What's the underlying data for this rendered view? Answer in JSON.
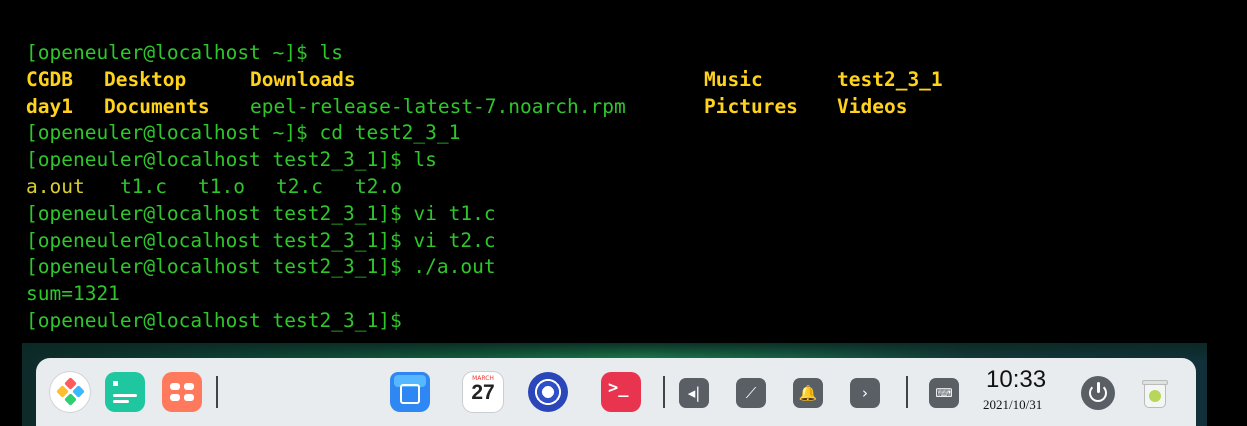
{
  "terminal": {
    "lines": [
      {
        "prompt": "[openeuler@localhost ~]$ ",
        "cmd": "ls"
      },
      {
        "prompt": "[openeuler@localhost ~]$ ",
        "cmd": "cd test2_3_1"
      },
      {
        "prompt": "[openeuler@localhost test2_3_1]$ ",
        "cmd": "ls"
      },
      {
        "prompt": "[openeuler@localhost test2_3_1]$ ",
        "cmd": "vi t1.c"
      },
      {
        "prompt": "[openeuler@localhost test2_3_1]$ ",
        "cmd": "vi t2.c"
      },
      {
        "prompt": "[openeuler@localhost test2_3_1]$ ",
        "cmd": "./a.out"
      },
      {
        "prompt": "[openeuler@localhost test2_3_1]$ ",
        "cmd": ""
      }
    ],
    "ls_home": {
      "row1": [
        "CGDB",
        "Desktop",
        "Downloads",
        "Music",
        "test2_3_1"
      ],
      "row2": [
        "day1",
        "Documents",
        "epel-release-latest-7.noarch.rpm",
        "Pictures",
        "Videos"
      ]
    },
    "ls_test": [
      "a.out",
      "t1.c",
      "t1.o",
      "t2.c",
      "t2.o"
    ],
    "program_output": "sum=1321"
  },
  "dock": {
    "icons": [
      "launcher-icon",
      "multitask-icon",
      "app-grid-icon",
      "app-store-icon",
      "calendar-icon",
      "settings-icon",
      "terminal-icon",
      "volume-icon",
      "network-icon",
      "notification-icon",
      "chevron-right-icon",
      "keyboard-icon",
      "power-icon",
      "trash-icon"
    ],
    "calendar": {
      "month": "MARCH",
      "day": "27"
    },
    "terminal_glyph": ">_",
    "clock": {
      "time": "10:33",
      "date": "2021/10/31"
    }
  },
  "colors": {
    "prompt": "#2fc62c",
    "dir": "#ffd21c",
    "file": "#d8cf2c",
    "dock_bg": "#e9ecef"
  }
}
